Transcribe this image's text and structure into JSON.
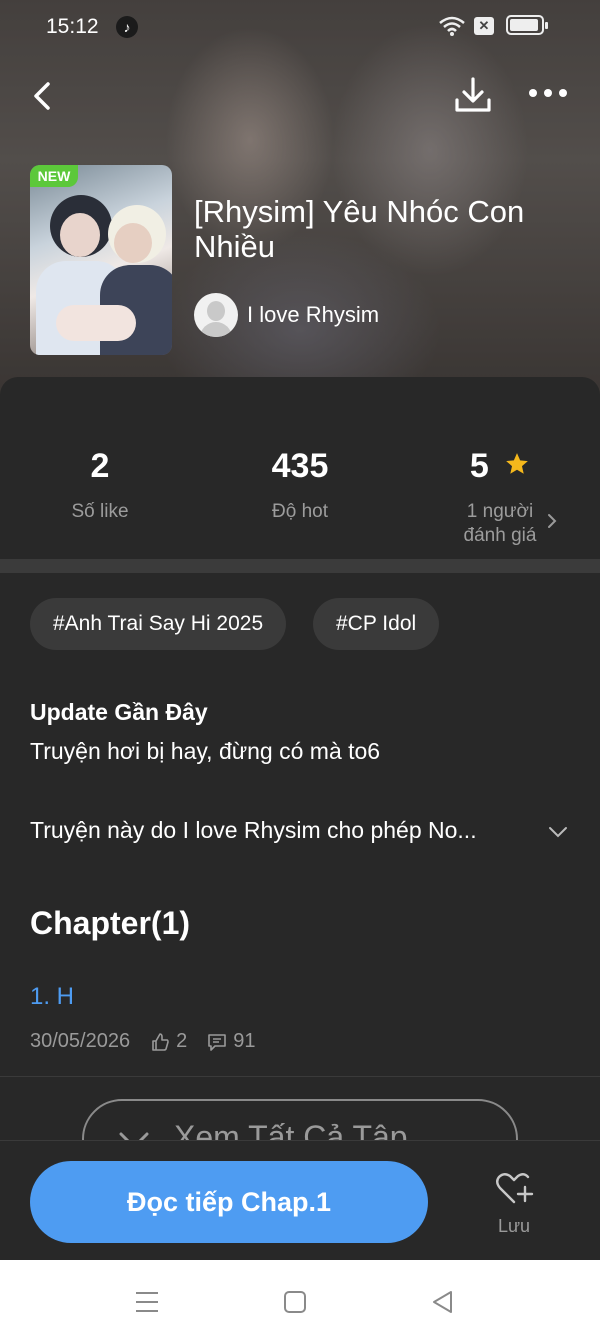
{
  "status_bar": {
    "time": "15:12"
  },
  "book": {
    "badge": "NEW",
    "title": "[Rhysim] Yêu Nhóc Con Nhiều",
    "author": "I love Rhysim"
  },
  "stats": [
    {
      "value": "2",
      "label": "Số like"
    },
    {
      "value": "435",
      "label": "Độ hot"
    },
    {
      "value": "5",
      "label_line1": "1 người",
      "label_line2": "đánh giá"
    }
  ],
  "tags": [
    "#Anh Trai Say Hi 2025",
    "#CP Idol"
  ],
  "update": {
    "heading": "Update Gần Đây",
    "text": "Truyện hơi bị hay, đừng có mà to6"
  },
  "description": "Truyện này do I love Rhysim cho phép No...",
  "chapters": {
    "heading": "Chapter(1)",
    "items": [
      {
        "title": "1. H",
        "date": "30/05/2026",
        "likes": "2",
        "comments": "91"
      }
    ]
  },
  "view_all_label": "Xem Tất Cả Tập",
  "bottom": {
    "read_button": "Đọc tiếp Chap.1",
    "save_label": "Lưu"
  },
  "colors": {
    "accent": "#4e9cf2",
    "new_badge": "#5cc83a",
    "star": "#f5b81c",
    "sheet_bg": "#282828"
  },
  "icons": [
    "back-icon",
    "download-icon",
    "more-icon",
    "star-icon",
    "chevron-right-icon",
    "chevron-down-icon",
    "thumbs-up-icon",
    "comment-icon",
    "heart-plus-icon",
    "menu-icon",
    "home-icon",
    "nav-back-icon"
  ]
}
